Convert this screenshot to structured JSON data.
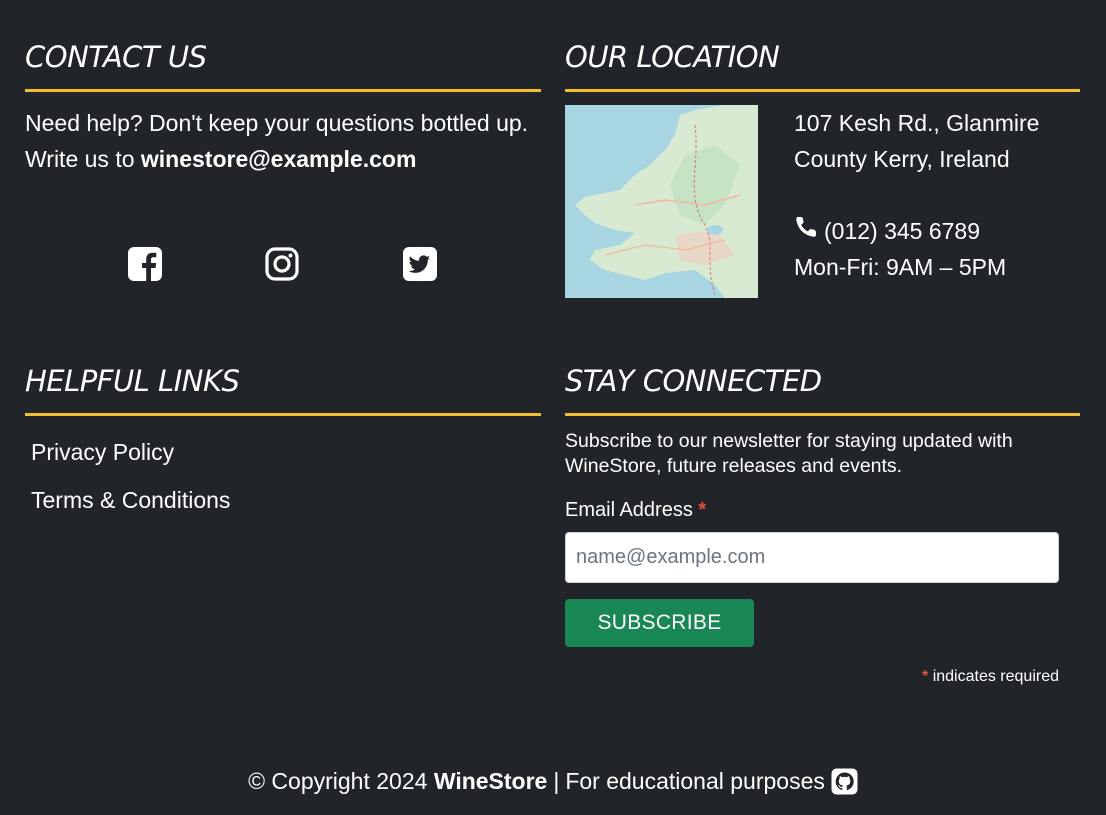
{
  "contact": {
    "heading": "CONTACT US",
    "line1": "Need help? Don't keep your questions bottled up.",
    "line2_prefix": "Write us to ",
    "email": "winestore@example.com",
    "social": [
      "facebook-icon",
      "instagram-icon",
      "twitter-icon"
    ]
  },
  "location": {
    "heading": "OUR LOCATION",
    "address_line1": "107 Kesh Rd., Glanmire",
    "address_line2": "County Kerry, Ireland",
    "phone": "(012) 345 6789",
    "hours": "Mon-Fri: 9AM – 5PM"
  },
  "links": {
    "heading": "HELPFUL LINKS",
    "items": [
      {
        "label": "Privacy Policy"
      },
      {
        "label": "Terms & Conditions"
      }
    ]
  },
  "newsletter": {
    "heading": "STAY CONNECTED",
    "description": "Subscribe to our newsletter for staying updated with WineStore, future releases and events.",
    "email_label": "Email Address",
    "required_mark": "*",
    "email_placeholder": "name@example.com",
    "subscribe_label": "SUBSCRIBE",
    "required_note": "indicates required"
  },
  "footer": {
    "copyright_prefix": "© Copyright 2024 ",
    "brand": "WineStore",
    "separator": "|",
    "purpose": "For educational purposes"
  },
  "colors": {
    "background": "#212529",
    "accent_rule": "#f0c030",
    "button": "#198754",
    "required": "#e0523c"
  }
}
